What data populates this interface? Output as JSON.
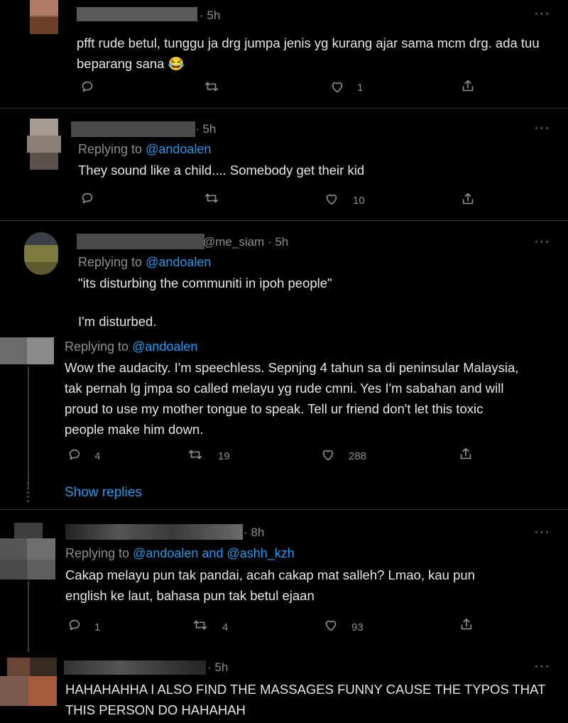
{
  "tweets": [
    {
      "time": "· 5h",
      "text": "pfft rude betul, tunggu ja drg jumpa jenis yg kurang ajar sama mcm drg. ada tuu beparang sana 😂",
      "likes": "1"
    },
    {
      "time": "· 5h",
      "replying_prefix": "Replying to",
      "replying_to": "@andoalen",
      "text": "They sound like a child.... Somebody get their kid",
      "likes": "10"
    },
    {
      "handle": "@me_siam",
      "time": "· 5h",
      "replying_prefix": "Replying to",
      "replying_to": "@andoalen",
      "text_line1": "\"its disturbing the communiti in ipoh people\"",
      "text_line2": "I'm disturbed."
    },
    {
      "replying_prefix": "Replying to",
      "replying_to": "@andoalen",
      "text": "Wow the audacity. I'm speechless. Sepnjng 4 tahun sa di peninsular Malaysia, tak pernah lg jmpa so called melayu yg rude cmni. Yes I'm sabahan and will proud to use my mother tongue to speak. Tell ur friend don't let this toxic people make him down.",
      "replies": "4",
      "retweets": "19",
      "likes": "288"
    },
    {
      "time": "· 8h",
      "replying_prefix": "Replying to",
      "replying_to": "@andoalen and @ashh_kzh",
      "text": "Cakap melayu pun tak pandai, acah cakap mat salleh? Lmao, kau pun english ke laut, bahasa pun tak betul ejaan",
      "replies": "1",
      "retweets": "4",
      "likes": "93"
    },
    {
      "time": "· 5h",
      "text": "HAHAHAHHA I ALSO FIND THE MASSAGES FUNNY CAUSE THE TYPOS THAT THIS PERSON DO HAHAHAH"
    }
  ],
  "show_replies": "Show replies",
  "more_label": "···",
  "colors": {
    "background": "#000000",
    "link": "#1d9bf0",
    "muted": "#8b8f94",
    "divider": "#2f3336"
  },
  "icons": [
    "reply-icon",
    "retweet-icon",
    "like-icon",
    "share-icon",
    "more-icon"
  ]
}
